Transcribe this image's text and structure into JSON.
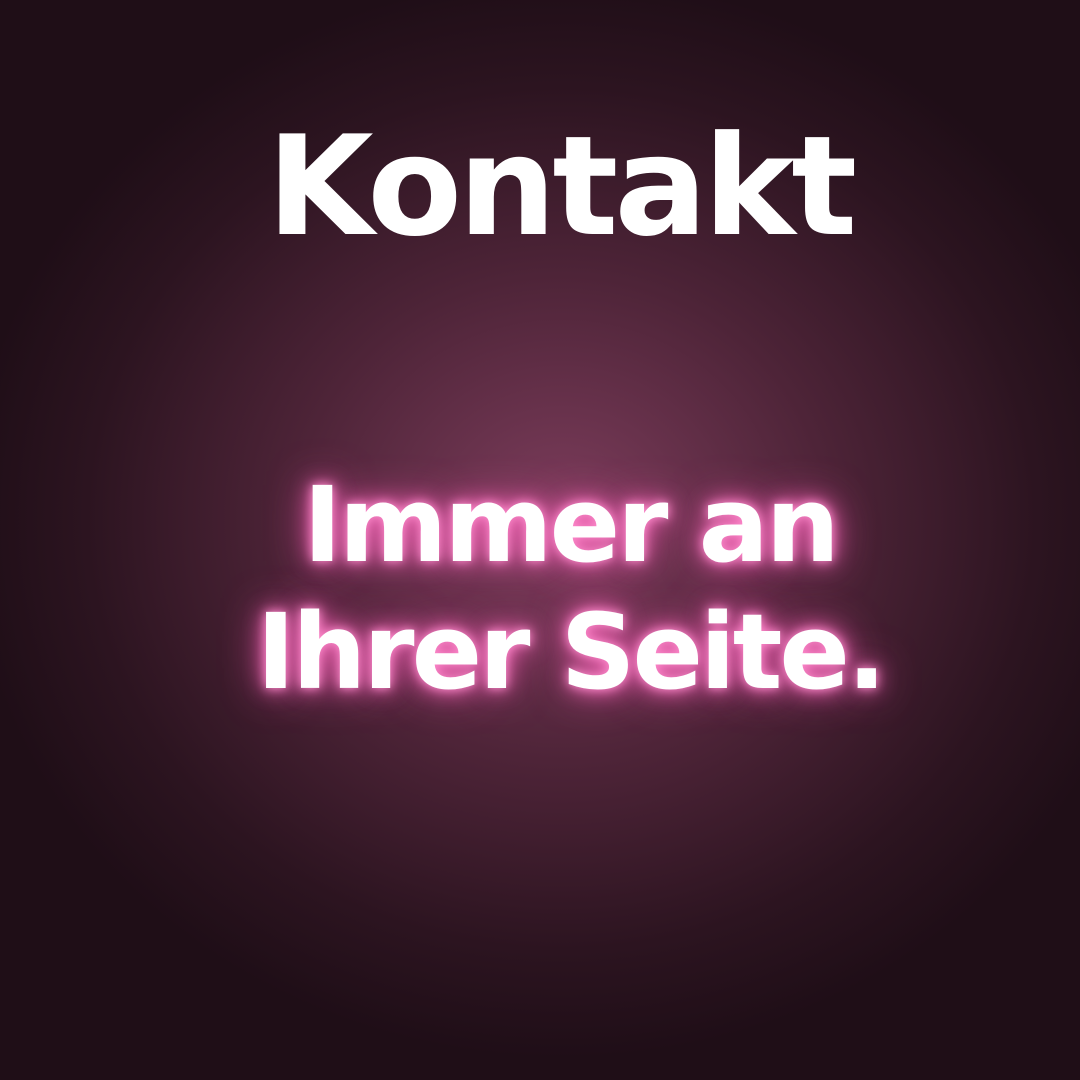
{
  "headline": "Kontakt",
  "slogan": {
    "line1": "Immer an",
    "line2": "Ihrer Seite."
  },
  "colors": {
    "background_center": "#7d3d5c",
    "background_edge": "#1f0e17",
    "text": "#ffffff",
    "glow": "#ff6fc0"
  }
}
